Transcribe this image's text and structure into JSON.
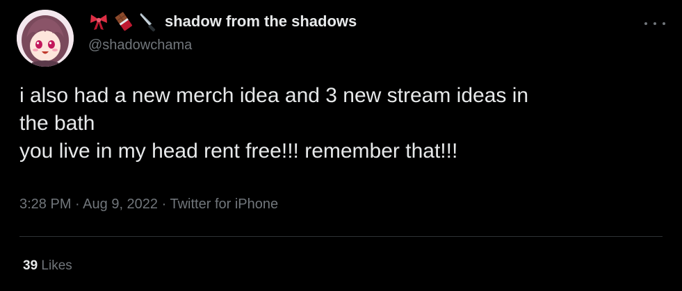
{
  "tweet": {
    "author": {
      "display_name": "shadow from the shadows",
      "handle": "@shadowchama",
      "avatar_icon": "anime-girl-avatar",
      "name_emojis": [
        "ribbon-emoji",
        "chocolate-bar-emoji",
        "kitchen-knife-emoji"
      ]
    },
    "more_icon": "more-options-icon",
    "text_lines": [
      "i also had a new merch idea and 3 new stream ideas in",
      "the bath",
      "you live in my head rent free!!! remember that!!!"
    ],
    "meta": {
      "time": "3:28 PM",
      "separator": "·",
      "date": "Aug 9, 2022",
      "source": "Twitter for iPhone"
    },
    "stats": {
      "likes_count": "39",
      "likes_label": "Likes"
    }
  },
  "colors": {
    "background": "#000000",
    "primary_text": "#e7e9ea",
    "secondary_text": "#71767b",
    "divider": "#2f3336"
  }
}
